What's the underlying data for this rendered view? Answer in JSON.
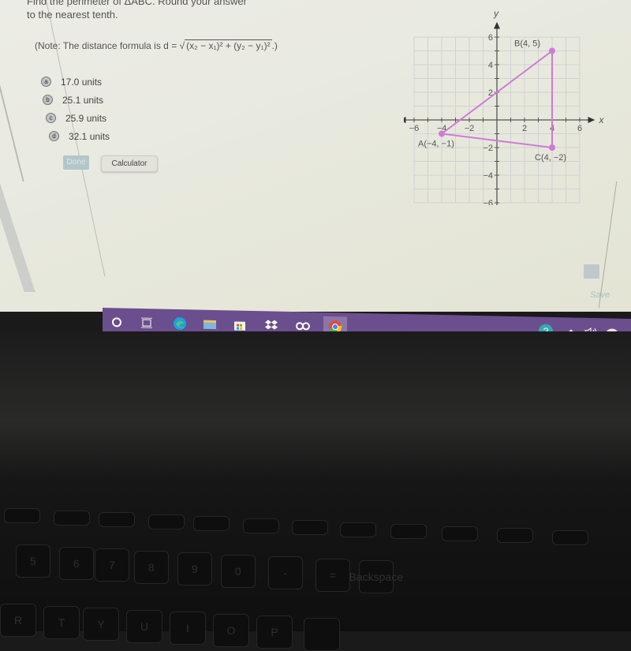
{
  "question": {
    "line1": "Find the perimeter of ΔABC. Round your answer",
    "line2": "to the nearest tenth.",
    "note_prefix": "(Note: The distance formula is d = ",
    "note_formula": "(x₂ − x₁)² + (y₂ − y₁)²",
    "note_suffix": ".)"
  },
  "options": [
    {
      "letter": "a",
      "label": "17.0 units"
    },
    {
      "letter": "b",
      "label": "25.1 units"
    },
    {
      "letter": "c",
      "label": "25.9 units"
    },
    {
      "letter": "d",
      "label": "32.1 units"
    }
  ],
  "buttons": {
    "done": "Done",
    "calculator": "Calculator",
    "save": "Save"
  },
  "graph": {
    "x_axis_label": "x",
    "y_axis_label": "y",
    "x_ticks": [
      "-6",
      "-4",
      "-2",
      "2",
      "4",
      "6"
    ],
    "y_ticks": [
      "6",
      "4",
      "2",
      "-2",
      "-4",
      "-6"
    ],
    "x_range": [
      -6,
      6
    ],
    "y_range": [
      -6,
      6
    ],
    "line_color": "#d07ad6",
    "points": [
      {
        "name": "A",
        "label": "A(−4, −1)",
        "x": -4,
        "y": -1
      },
      {
        "name": "B",
        "label": "B(4, 5)",
        "x": 4,
        "y": 5
      },
      {
        "name": "C",
        "label": "C(4, −2)",
        "x": 4,
        "y": -2
      }
    ]
  },
  "taskbar": {
    "icons": [
      "search-icon",
      "task-view-icon",
      "edge-icon",
      "file-explorer-icon",
      "store-icon",
      "dropbox-icon",
      "infinity-app-icon",
      "chrome-icon"
    ],
    "tray": [
      "help-icon",
      "chevron-up-icon",
      "volume-icon",
      "network-icon"
    ]
  },
  "keyboard": {
    "visible_keys": [
      "5",
      "6",
      "7",
      "8",
      "9",
      "0",
      "-",
      "=",
      "Backspace",
      "R",
      "T",
      "Y",
      "U",
      "I",
      "O",
      "P"
    ]
  }
}
